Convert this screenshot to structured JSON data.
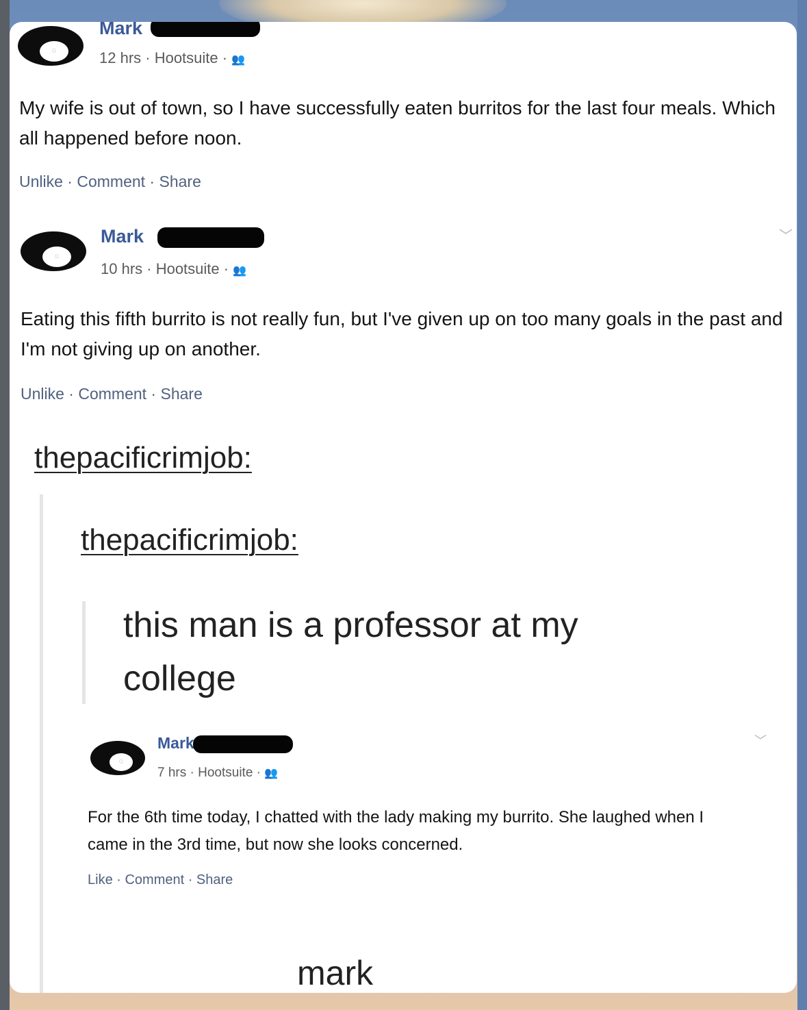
{
  "posts": [
    {
      "name": "Mark",
      "meta": "12 hrs · Hootsuite · ",
      "text": "My wife is out of town, so I have successfully eaten burritos for the last four meals. Which all happened before noon.",
      "actions": "Unlike · Comment · Share"
    },
    {
      "name": "Mark",
      "meta": "10 hrs · Hootsuite · ",
      "text": "Eating this fifth burrito is not really fun, but I've given up on too many goals in the past and I'm not giving up on another.",
      "actions": "Unlike · Comment · Share"
    },
    {
      "name": "Mark",
      "meta": "7 hrs · Hootsuite · ",
      "text": "For the 6th time today, I chatted with the lady making my burrito. She laughed when I came in the 3rd time, but now she looks concerned.",
      "actions": "Like · Comment · Share"
    }
  ],
  "tumblr": {
    "user1": "thepacificrimjob:",
    "user2": "thepacificrimjob:",
    "quote": "this man is a professor at my college",
    "reply": "mark"
  }
}
